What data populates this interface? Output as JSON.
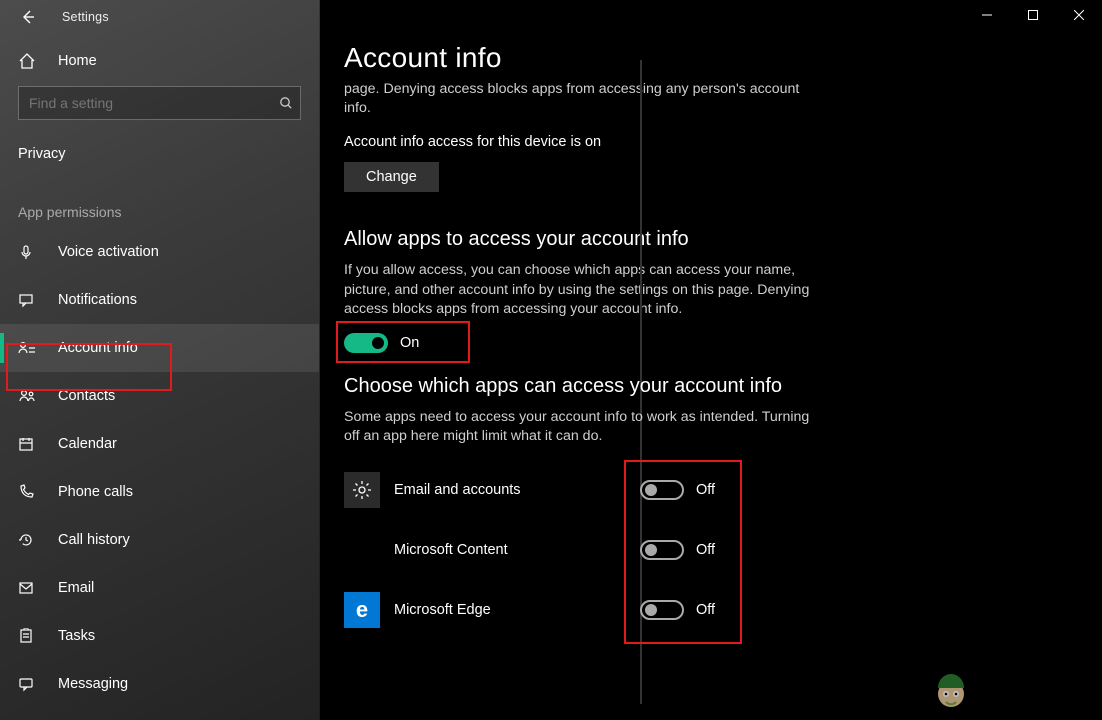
{
  "window": {
    "app_title": "Settings"
  },
  "sidebar": {
    "home_label": "Home",
    "search_placeholder": "Find a setting",
    "category_label": "Privacy",
    "section_label": "App permissions",
    "items": [
      {
        "id": "voice-activation",
        "label": "Voice activation",
        "icon": "mic-icon"
      },
      {
        "id": "notifications",
        "label": "Notifications",
        "icon": "chat-icon"
      },
      {
        "id": "account-info",
        "label": "Account info",
        "icon": "person-list-icon",
        "selected": true
      },
      {
        "id": "contacts",
        "label": "Contacts",
        "icon": "contacts-icon"
      },
      {
        "id": "calendar",
        "label": "Calendar",
        "icon": "calendar-icon"
      },
      {
        "id": "phone-calls",
        "label": "Phone calls",
        "icon": "phone-icon"
      },
      {
        "id": "call-history",
        "label": "Call history",
        "icon": "history-icon"
      },
      {
        "id": "email",
        "label": "Email",
        "icon": "mail-icon"
      },
      {
        "id": "tasks",
        "label": "Tasks",
        "icon": "tasks-icon"
      },
      {
        "id": "messaging",
        "label": "Messaging",
        "icon": "message-icon"
      }
    ]
  },
  "main": {
    "page_title": "Account info",
    "intro_fragment": "page. Denying access blocks apps from accessing any person's account info.",
    "device_access_status": "Account info access for this device is on",
    "change_button": "Change",
    "allow_apps": {
      "heading": "Allow apps to access your account info",
      "description": "If you allow access, you can choose which apps can access your name, picture, and other account info by using the settings on this page. Denying access blocks apps from accessing your account info.",
      "toggle_state": "On",
      "toggle_on": true
    },
    "choose_apps": {
      "heading": "Choose which apps can access your account info",
      "description": "Some apps need to access your account info to work as intended. Turning off an app here might limit what it can do.",
      "apps": [
        {
          "name": "Email and accounts",
          "state": "Off",
          "icon": "gear"
        },
        {
          "name": "Microsoft Content",
          "state": "Off",
          "icon": "mslogo"
        },
        {
          "name": "Microsoft Edge",
          "state": "Off",
          "icon": "edge"
        }
      ]
    }
  }
}
